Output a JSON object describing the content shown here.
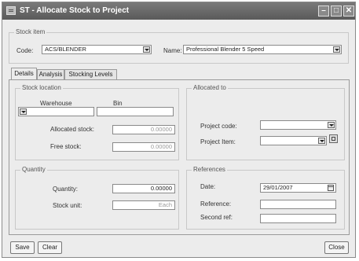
{
  "window": {
    "title": "ST - Allocate Stock to Project"
  },
  "stock_item": {
    "group_label": "Stock item",
    "code_label": "Code:",
    "code_value": "ACS/BLENDER",
    "name_label": "Name:",
    "name_value": "Professional Blender 5 Speed"
  },
  "tabs": [
    {
      "label": "Details"
    },
    {
      "label": "Analysis"
    },
    {
      "label": "Stocking Levels"
    }
  ],
  "stock_location": {
    "group_label": "Stock location",
    "warehouse_header": "Warehouse",
    "bin_header": "Bin",
    "warehouse_value": "",
    "bin_value": "",
    "allocated_label": "Allocated stock:",
    "allocated_value": "0.00000",
    "free_label": "Free stock:",
    "free_value": "0.00000"
  },
  "allocated_to": {
    "group_label": "Allocated to",
    "project_code_label": "Project code:",
    "project_code_value": "",
    "project_item_label": "Project Item:",
    "project_item_value": ""
  },
  "quantity": {
    "group_label": "Quantity",
    "quantity_label": "Quantity:",
    "quantity_value": "0.00000",
    "stock_unit_label": "Stock unit:",
    "stock_unit_value": "Each"
  },
  "references": {
    "group_label": "References",
    "date_label": "Date:",
    "date_value": "29/01/2007",
    "reference_label": "Reference:",
    "reference_value": "",
    "second_ref_label": "Second ref:",
    "second_ref_value": ""
  },
  "footer": {
    "save_label": "Save",
    "clear_label": "Clear",
    "close_label": "Close"
  },
  "icons": {
    "minimize": "minimize-icon",
    "maximize": "maximize-icon",
    "close": "close-icon"
  }
}
